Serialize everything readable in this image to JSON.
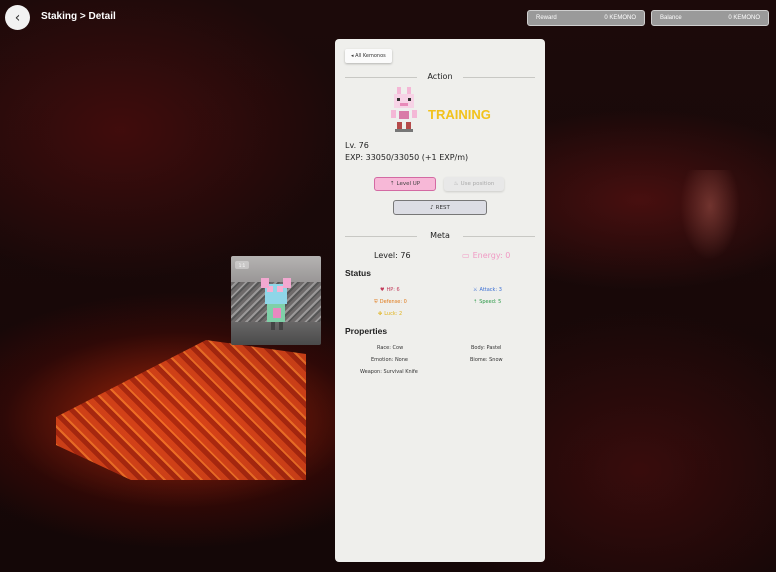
{
  "header": {
    "back_label": "‹",
    "breadcrumb": "Staking > Detail",
    "reward_label": "Reward",
    "reward_value": "0 KEMONO",
    "balance_label": "Balance",
    "balance_value": "0 KEMONO"
  },
  "panel": {
    "all_button": "◂ All Kemonos",
    "action_title": "Action",
    "status_word": "TRAINING",
    "level_line": "Lv. 76",
    "exp_line": "EXP: 33050/33050 (+1 EXP/m)",
    "level_up_label": "Level UP",
    "use_potion_label": "Use position",
    "rest_label": "REST",
    "meta_title": "Meta",
    "meta_level": "Level: 76",
    "meta_energy": "Energy: 0",
    "status_heading": "Status",
    "stats": {
      "hp": "HP: 6",
      "attack": "Attack: 3",
      "defense": "Defense: 0",
      "speed": "Speed: 5",
      "luck": "Luck: 2"
    },
    "properties_heading": "Properties",
    "properties": {
      "race": "Race: Cow",
      "body": "Body: Pastel",
      "emotion": "Emotion: None",
      "biome": "Biome: Snow",
      "weapon": "Weapon: Survival Knife"
    }
  },
  "preview": {
    "badge": "1:1"
  },
  "colors": {
    "training": "#f2c21b",
    "level_up_bg": "#f7b8d7",
    "energy": "#f09ac4",
    "hp": "#c23a5a",
    "attack": "#3b6fd4",
    "defense": "#e07a1a",
    "speed": "#2e9a4a",
    "luck": "#e0b21a"
  },
  "icons": {
    "back": "chevron-left-icon",
    "level_up": "arrow-up-icon",
    "potion": "flask-icon",
    "rest": "sleep-icon",
    "energy": "battery-empty-icon",
    "hp": "heart-icon",
    "attack": "sword-icon",
    "defense": "shield-icon",
    "speed": "arrow-up-icon",
    "luck": "clover-icon"
  }
}
